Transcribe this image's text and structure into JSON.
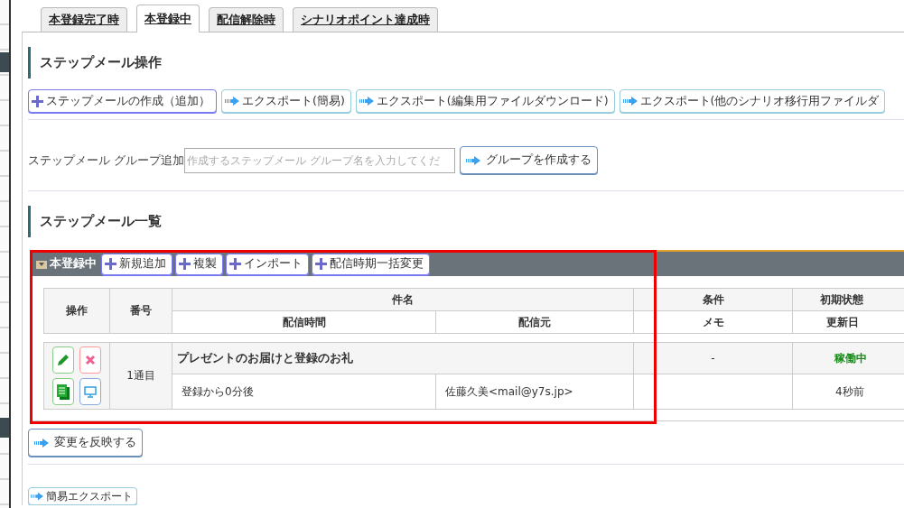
{
  "tabs": [
    {
      "label": "本登録完了時",
      "selected": false
    },
    {
      "label": "本登録中",
      "selected": true
    },
    {
      "label": "配信解除時",
      "selected": false
    },
    {
      "label": "シナリオポイント達成時",
      "selected": false
    }
  ],
  "operations": {
    "title": "ステップメール操作",
    "buttons": [
      {
        "label": "ステップメールの作成（追加）",
        "kind": "add"
      },
      {
        "label": "エクスポート(簡易)",
        "kind": "export"
      },
      {
        "label": "エクスポート(編集用ファイルダウンロード)",
        "kind": "export"
      },
      {
        "label": "エクスポート(他のシナリオ移行用ファイルダ",
        "kind": "export"
      }
    ]
  },
  "group_add": {
    "label": "ステップメール グループ追加",
    "placeholder": "作成するステップメール グループ名を入力してくだ",
    "button": "グループを作成する"
  },
  "list": {
    "title": "ステップメール一覧",
    "group": {
      "name": "本登録中",
      "expanded": true,
      "buttons": [
        "新規追加",
        "複製",
        "インポート",
        "配信時期一括変更"
      ],
      "columns": {
        "top": [
          "操作",
          "番号",
          "件名",
          "条件",
          "初期状態"
        ],
        "sub": [
          "配信時間",
          "配信元",
          "メモ",
          "更新日"
        ]
      },
      "rows": [
        {
          "number": "1通目",
          "subject": "プレゼントのお届けと登録のお礼",
          "condition": "-",
          "status": "稼働中",
          "active": true,
          "timing": "登録から0分後",
          "sender": "佐藤久美<mail@y7s.jp>",
          "updated": "4秒前"
        }
      ]
    }
  },
  "apply_button": "変更を反映する",
  "simple_export_button": "簡易エクスポート"
}
